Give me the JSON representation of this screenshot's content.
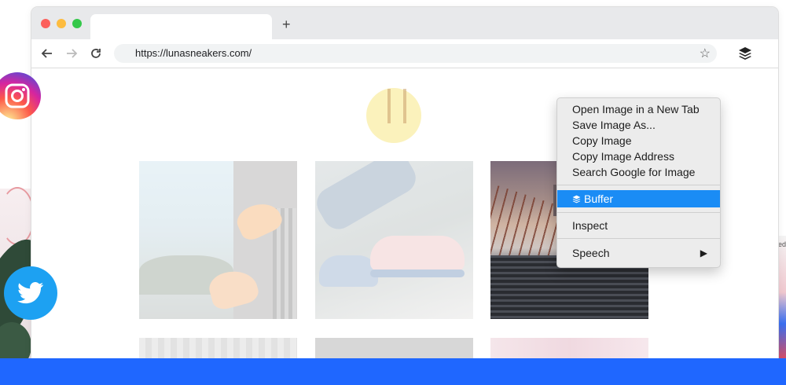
{
  "browser": {
    "tab_new_symbol": "+",
    "url": "https://lunasneakers.com/",
    "bookmark_icon": "star-outline-icon",
    "extension_icon": "buffer-layers-icon"
  },
  "context_menu": {
    "items": [
      {
        "label": "Open Image in a New Tab"
      },
      {
        "label": "Save Image As..."
      },
      {
        "label": "Copy Image"
      },
      {
        "label": "Copy Image Address"
      },
      {
        "label": "Search Google for Image"
      },
      {
        "label": "Buffer",
        "highlighted": true
      },
      {
        "label": "Inspect"
      },
      {
        "label": "Speech",
        "submenu_arrow": "▶"
      }
    ]
  },
  "colors": {
    "highlight": "#1a8cf5",
    "bottom_bar": "#1f67ff",
    "twitter": "#1da1f2"
  },
  "social_icons": [
    "instagram-icon",
    "twitter-icon"
  ]
}
